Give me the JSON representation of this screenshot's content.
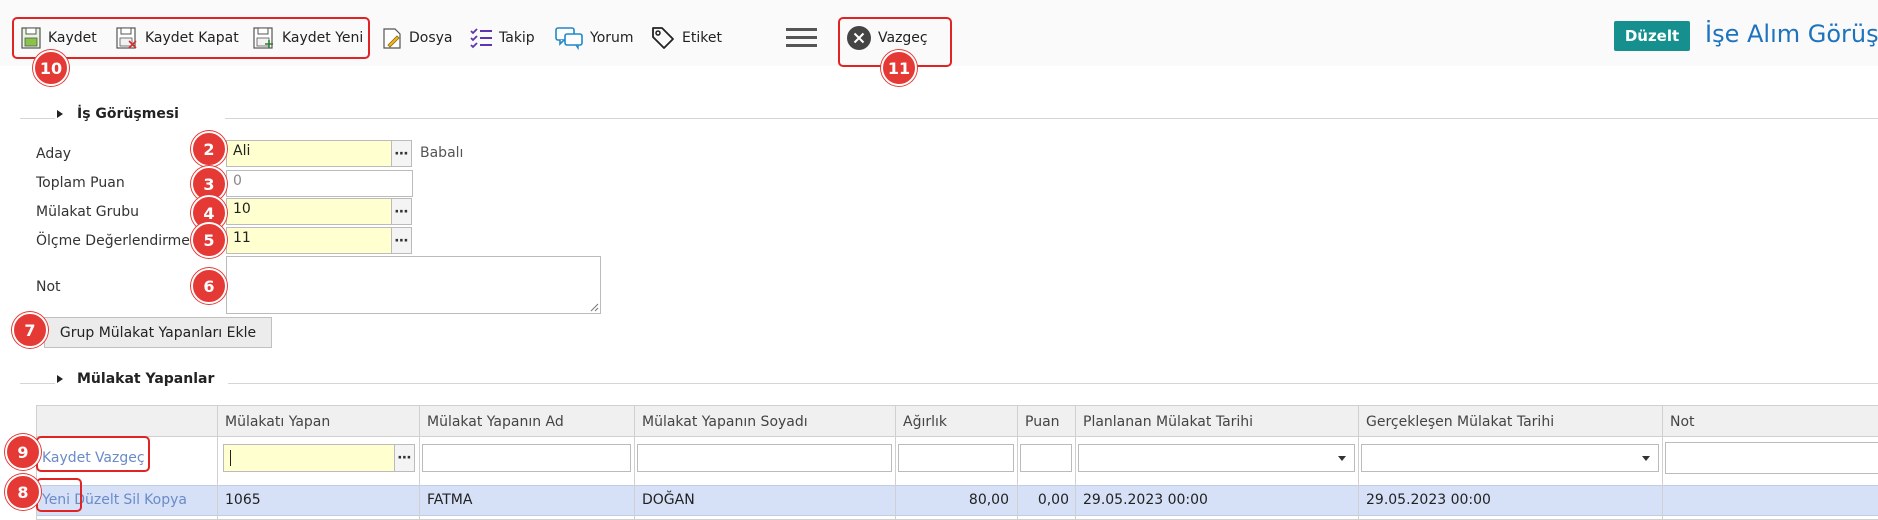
{
  "toolbar": {
    "kaydet": "Kaydet",
    "kaydet_kapat": "Kaydet Kapat",
    "kaydet_yeni": "Kaydet Yeni",
    "dosya": "Dosya",
    "takip": "Takip",
    "yorum": "Yorum",
    "etiket": "Etiket",
    "vazgec": "Vazgeç",
    "duzelt": "Düzelt",
    "page_title": "İşe Alım Görüşme"
  },
  "badges": {
    "b2": "2",
    "b3": "3",
    "b4": "4",
    "b5": "5",
    "b6": "6",
    "b7": "7",
    "b8": "8",
    "b9": "9",
    "b10": "10",
    "b11": "11"
  },
  "section1": {
    "title": "İş Görüşmesi",
    "fields": {
      "aday_label": "Aday",
      "aday_value": "Ali",
      "aday_extra": "Babalı",
      "toplam_label": "Toplam Puan",
      "toplam_value": "0",
      "grup_label": "Mülakat Grubu",
      "grup_value": "10",
      "olcme_label": "Ölçme Değerlendirme",
      "olcme_value": "11",
      "not_label": "Not",
      "not_value": ""
    },
    "button": "Grup Mülakat Yapanları Ekle"
  },
  "section2": {
    "title": "Mülakat Yapanlar",
    "columns": [
      "Mülakatı Yapan",
      "Mülakat Yapanın Ad",
      "Mülakat Yapanın Soyadı",
      "Ağırlık",
      "Puan",
      "Planlanan Mülakat Tarihi",
      "Gerçekleşen Mülakat Tarihi",
      "Not"
    ],
    "edit_actions": {
      "kaydet": "Kaydet",
      "vazgec": "Vazgeç"
    },
    "row_actions": {
      "yeni": "Yeni",
      "duzelt": "Düzelt",
      "sil": "Sil",
      "kopya": "Kopya"
    },
    "row": {
      "yapan": "1065",
      "ad": "FATMA",
      "soyad": "DOĞAN",
      "agirlik": "80,00",
      "puan": "0,00",
      "planlanan": "29.05.2023 00:00",
      "gerceklesen": "29.05.2023 00:00",
      "not": ""
    }
  },
  "colors": {
    "accent": "#15908f",
    "title": "#1e73be",
    "badge": "#e53935",
    "required": "#ffffd0",
    "selected_row": "#d6e1f7"
  }
}
